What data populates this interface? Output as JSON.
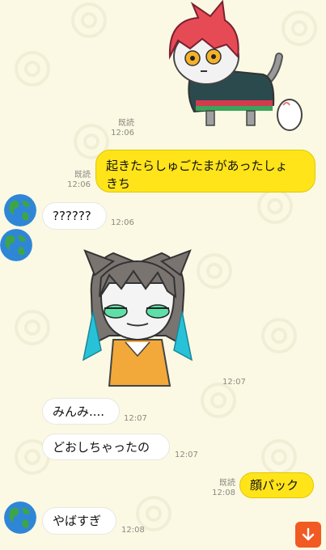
{
  "colors": {
    "background": "#fbf9e4",
    "mine_bubble": "#ffe41a",
    "their_bubble": "#ffffff",
    "scroll_button": "#f15a22"
  },
  "messages": [
    {
      "id": "m1",
      "side": "mine",
      "type": "sticker",
      "read": "既読",
      "time": "12:06",
      "sticker_icon": "red-cat-character-sticker"
    },
    {
      "id": "m2",
      "side": "mine",
      "type": "text",
      "read": "既読",
      "time": "12:06",
      "text_line1": "起きたらしゅごたまがあったしょ",
      "text_line2": "きち"
    },
    {
      "id": "m3",
      "side": "theirs",
      "type": "text",
      "time": "12:06",
      "text": "??????"
    },
    {
      "id": "m4",
      "side": "theirs",
      "type": "sticker",
      "time": "12:07",
      "sticker_icon": "gray-cat-character-sticker"
    },
    {
      "id": "m5",
      "side": "theirs",
      "type": "text",
      "time": "12:07",
      "text": "みんみ...."
    },
    {
      "id": "m6",
      "side": "theirs",
      "type": "text",
      "time": "12:07",
      "text": "どおしちゃったの"
    },
    {
      "id": "m7",
      "side": "mine",
      "type": "text",
      "read": "既読",
      "time": "12:08",
      "text": "顔パック"
    },
    {
      "id": "m8",
      "side": "theirs",
      "type": "text",
      "time": "12:08",
      "text": "やばすぎ"
    }
  ],
  "avatar_icon": "earth-globe-icon",
  "scroll_button_icon": "arrow-down-icon"
}
